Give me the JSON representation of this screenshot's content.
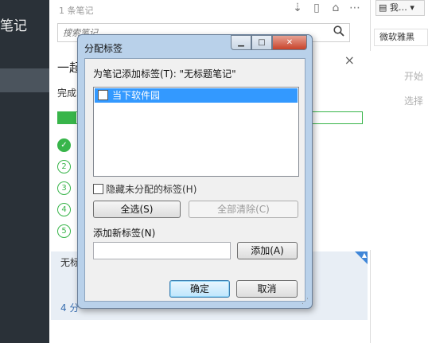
{
  "sidebar": {
    "app_title": "笔记"
  },
  "note_list": {
    "count_text": "1 条笔记",
    "search": {
      "placeholder": "搜索笔记"
    },
    "icons": [
      "sort-icon",
      "view-toggle-icon",
      "reminder-icon",
      "more-icon"
    ]
  },
  "intro": {
    "title": "一起",
    "subtitle": "完成",
    "close": "×",
    "progress_fraction": 0.06,
    "steps": [
      "✓",
      "2",
      "3",
      "4",
      "5"
    ]
  },
  "note_card": {
    "title": "无标",
    "meta": "4 分"
  },
  "editor": {
    "notebook_label": "我…",
    "font": "微软雅黑",
    "placeholder_line1": "开始",
    "placeholder_line2": "选择"
  },
  "dialog": {
    "title": "分配标签",
    "add_label": "为笔记添加标签(T): \"无标题笔记\"",
    "tags": [
      {
        "name": "当下软件园",
        "checked": false,
        "selected": true
      }
    ],
    "hide_unassigned": "隐藏未分配的标签(H)",
    "select_all": "全选(S)",
    "clear_all": "全部清除(C)",
    "new_tag_label": "添加新标签(N)",
    "new_tag_value": "",
    "add_button": "添加(A)",
    "ok_button": "确定",
    "cancel_button": "取消"
  },
  "colors": {
    "sidebar": "#2a3138",
    "accent_green": "#38b54a",
    "selection_blue": "#3399ff",
    "dialog_frame": "#b9d1ea"
  }
}
